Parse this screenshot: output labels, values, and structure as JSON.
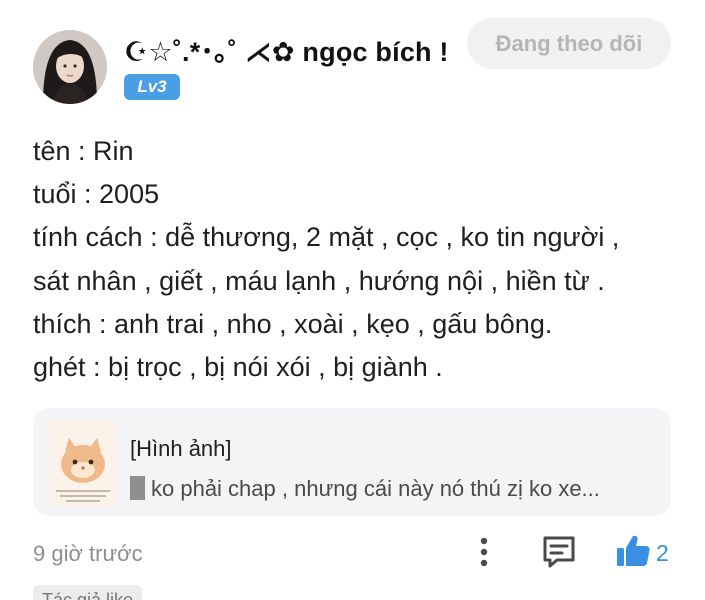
{
  "post": {
    "author": {
      "name": "☪︎☆˚.*･｡˚ ⋌✿ ngọc bích !",
      "level": "Lv3",
      "follow_label": "Đang theo dõi"
    },
    "body_lines": [
      "tên : Rin",
      "tuổi : 2005",
      "tính cách : dễ thương, 2 mặt , cọc , ko tin người ,",
      "sát nhân , giết , máu lạnh , hướng nội , hiền từ .",
      "thích : anh trai , nho , xoài , kẹo , gấu bông.",
      "ghét : bị trọc , bị nói xói , bị giành ."
    ],
    "quote": {
      "title": "[Hình ảnh]",
      "snippet": "ko phải chap , nhưng cái này nó thú zị ko xe..."
    },
    "timestamp": "9 giờ trước",
    "like_count": "2",
    "author_like_tag": "Tác giả like"
  },
  "icons": {
    "more": "more-vertical-icon",
    "comment": "comment-icon",
    "like": "thumbs-up-icon"
  },
  "colors": {
    "accent_blue": "#3b8fe3",
    "badge_blue": "#4a9ee6",
    "follow_bg": "#f1f1f1",
    "follow_text": "#b5b5b5",
    "card_bg": "#f4f4f6",
    "muted_text": "#8e8e8e"
  }
}
